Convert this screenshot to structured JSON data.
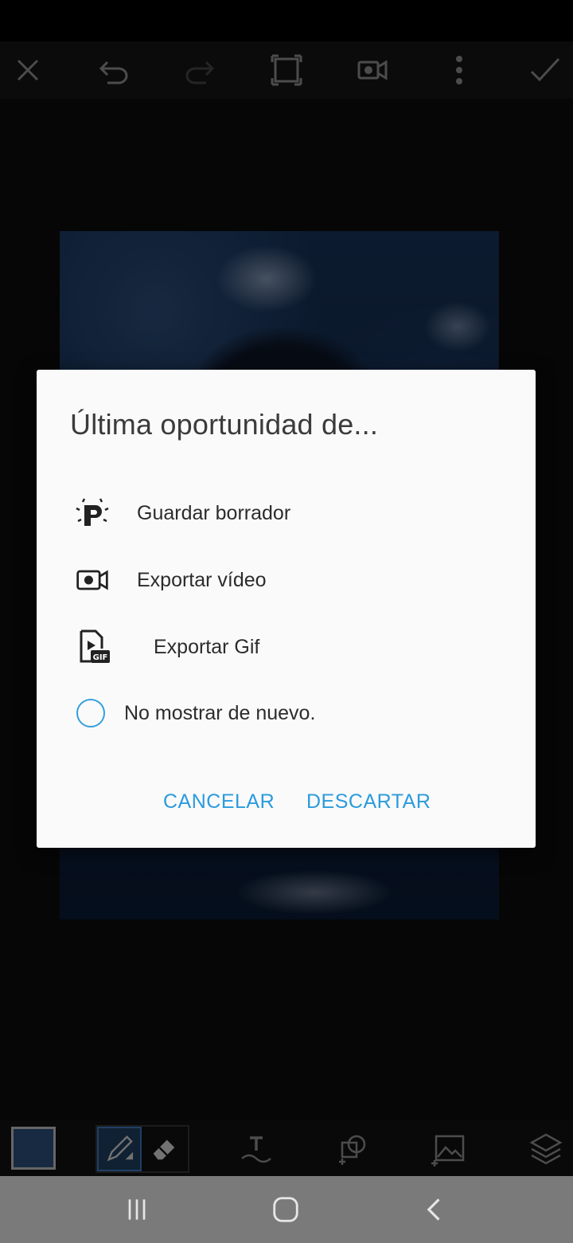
{
  "top_toolbar": {
    "icons": [
      "close-icon",
      "undo-icon",
      "redo-icon",
      "crop-icon",
      "video-record-icon",
      "more-vert-icon",
      "check-icon"
    ]
  },
  "dialog": {
    "title": "Última oportunidad de...",
    "options": [
      {
        "icon": "picsart-logo-icon",
        "label": "Guardar borrador"
      },
      {
        "icon": "video-camera-icon",
        "label": "Exportar vídeo"
      },
      {
        "icon": "gif-file-icon",
        "label": "Exportar Gif"
      }
    ],
    "checkbox_label": "No mostrar de nuevo.",
    "checkbox_checked": false,
    "cancel_label": "CANCELAR",
    "discard_label": "DESCARTAR",
    "accent_color": "#2b9bdc"
  },
  "bottom_toolbar": {
    "selected_color": "#2c4d79",
    "tools": [
      "brush-icon",
      "eraser-icon",
      "text-icon",
      "sticker-icon",
      "add-photo-icon",
      "layers-icon"
    ]
  },
  "nav_bar": {
    "buttons": [
      "recent-apps-icon",
      "home-icon",
      "back-icon"
    ]
  }
}
